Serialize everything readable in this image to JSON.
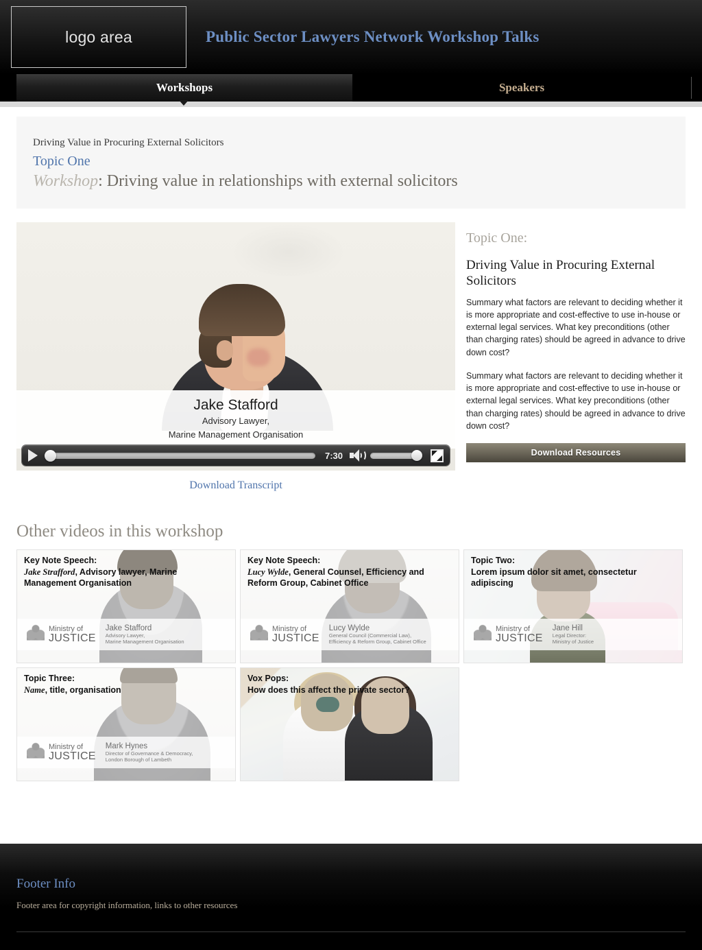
{
  "header": {
    "logo_label": "logo area",
    "site_title": "Public Sector Lawyers Network Workshop Talks"
  },
  "tabs": [
    {
      "label": "Workshops",
      "active": true
    },
    {
      "label": "Speakers",
      "active": false
    }
  ],
  "title_block": {
    "kicker": "Driving Value in Procuring External Solicitors",
    "topic": "Topic One",
    "main_italic": "Workshop",
    "main_rest": ": Driving value in relationships with external solicitors"
  },
  "video": {
    "caption_name": "Jake Stafford",
    "caption_role_line1": "Advisory Lawyer,",
    "caption_role_line2": "Marine Management Organisation",
    "time": "7:30",
    "play_icon": "play-icon",
    "volume_icon": "speaker-icon",
    "fullscreen_icon": "fullscreen-icon",
    "transcript_link": "Download Transcript"
  },
  "side": {
    "kicker": "Topic One:",
    "title": "Driving Value in Procuring External Solicitors",
    "para1": "Summary what factors are relevant to deciding whether it is more appropriate and cost-effective to use in-house or external legal services. What key preconditions (other than charging rates) should be agreed in advance to drive down cost?",
    "para2": "Summary what factors are relevant to deciding whether it is more appropriate and cost-effective to use in-house or external legal services. What key preconditions (other than charging rates) should be agreed in advance to drive down cost?",
    "download_button": "Download Resources"
  },
  "other_videos": {
    "heading": "Other videos in this workshop",
    "items": [
      {
        "label_line1": "Key Note Speech:",
        "label_italic": "Jake Strafford",
        "label_rest": ", Advisory lawyer, Marine Management Organisation",
        "lower_brand_line1": "Ministry of",
        "lower_brand_line2": "JUSTICE",
        "person_name": "Jake Stafford",
        "person_role1": "Advisory Lawyer,",
        "person_role2": "Marine Management Organisation",
        "art": "art-man1"
      },
      {
        "label_line1": "Key Note Speech:",
        "label_italic": "Lucy Wylde",
        "label_rest": ", General Counsel, Efficiency and Reform Group, Cabinet Office",
        "lower_brand_line1": "Ministry of",
        "lower_brand_line2": "JUSTICE",
        "person_name": "Lucy Wylde",
        "person_role1": "General Council (Commercial Law),",
        "person_role2": "Efficiency & Reform Group, Cabinet Office",
        "art": "art-woman1"
      },
      {
        "label_line1": "Topic Two:",
        "label_italic": "",
        "label_rest": "Lorem ipsum dolor sit amet, consectetur adipiscing",
        "lower_brand_line1": "Ministry of",
        "lower_brand_line2": "JUSTICE",
        "person_name": "Jane Hill",
        "person_role1": "Legal Director:",
        "person_role2": "Ministry of Justice",
        "art": "art-woman2"
      },
      {
        "label_line1": "Topic Three:",
        "label_italic": "Name",
        "label_rest": ", title, organisation",
        "lower_brand_line1": "Ministry of",
        "lower_brand_line2": "JUSTICE",
        "person_name": "Mark Hynes",
        "person_role1": "Director of Governance & Democracy,",
        "person_role2": "London Borough of Lambeth",
        "art": "art-man2"
      },
      {
        "label_line1": "Vox Pops:",
        "label_italic": "",
        "label_rest": "How does this affect the private sector?",
        "lower_brand_line1": "",
        "lower_brand_line2": "",
        "person_name": "",
        "person_role1": "",
        "person_role2": "",
        "art": "art-vox"
      }
    ]
  },
  "footer": {
    "title": "Footer Info",
    "text": "Footer area for copyright information, links to other resources"
  },
  "colors": {
    "accent_blue": "#6d8fc4",
    "link_blue": "#4f74ab",
    "tab_inactive": "#c4ad8f",
    "button_olive_light": "#8d8878",
    "button_olive_dark": "#4a463c",
    "header_black": "#000000",
    "panel_grey": "#f6f6f6"
  }
}
